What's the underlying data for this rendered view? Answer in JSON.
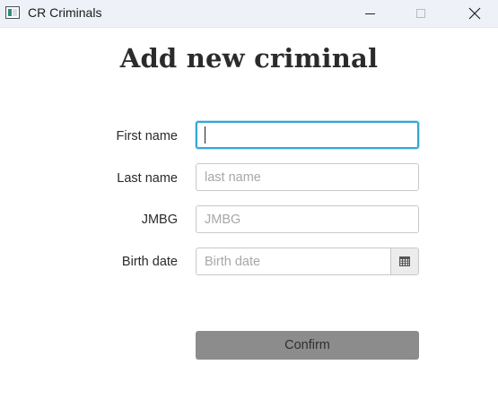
{
  "window": {
    "title": "CR Criminals",
    "icon": "app-icon"
  },
  "form": {
    "heading": "Add new criminal",
    "fields": [
      {
        "label": "First name",
        "value": "",
        "placeholder": "",
        "focused": true
      },
      {
        "label": "Last name",
        "value": "",
        "placeholder": "last name"
      },
      {
        "label": "JMBG",
        "value": "",
        "placeholder": "JMBG"
      },
      {
        "label": "Birth date",
        "value": "",
        "placeholder": "Birth date",
        "icon": "calendar-icon"
      }
    ],
    "confirm_label": "Confirm"
  },
  "colors": {
    "focus_border": "#34a7d6",
    "confirm_bg": "#8c8c8c",
    "titlebar_bg": "#eef2f8"
  }
}
